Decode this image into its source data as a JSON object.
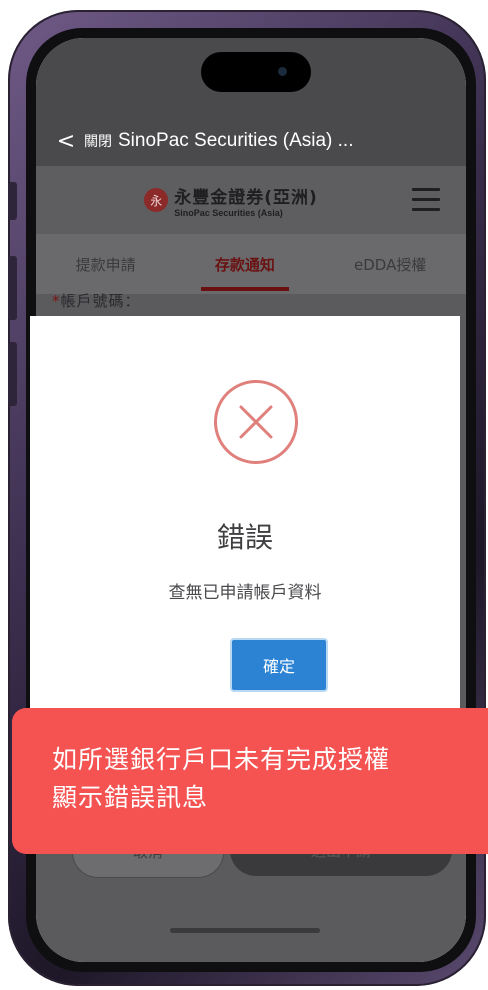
{
  "nav": {
    "back_symbol": "<",
    "close_label": "關閉",
    "title": "SinoPac Securities (Asia) ..."
  },
  "brand": {
    "logo_glyph": "永",
    "name_zh": "永豐金證券(亞洲)",
    "name_en": "SinoPac Securities (Asia)"
  },
  "tabs": [
    {
      "label": "提款申請",
      "active": false
    },
    {
      "label": "存款通知",
      "active": true
    },
    {
      "label": "eDDA授權",
      "active": false
    }
  ],
  "form": {
    "required_mark": "*",
    "account_label": "帳戶號碼："
  },
  "buttons": {
    "cancel": "取消",
    "submit": "送出申請"
  },
  "dialog": {
    "title": "錯誤",
    "message": "查無已申請帳戶資料",
    "confirm": "確定"
  },
  "annotation": {
    "line1": "如所選銀行戶口未有完成授權",
    "line2": "顯示錯誤訊息"
  },
  "colors": {
    "accent_red": "#6b1010",
    "dialog_button": "#2c83d4",
    "error_icon": "#e0807c",
    "annotation_bg": "#f55252"
  }
}
